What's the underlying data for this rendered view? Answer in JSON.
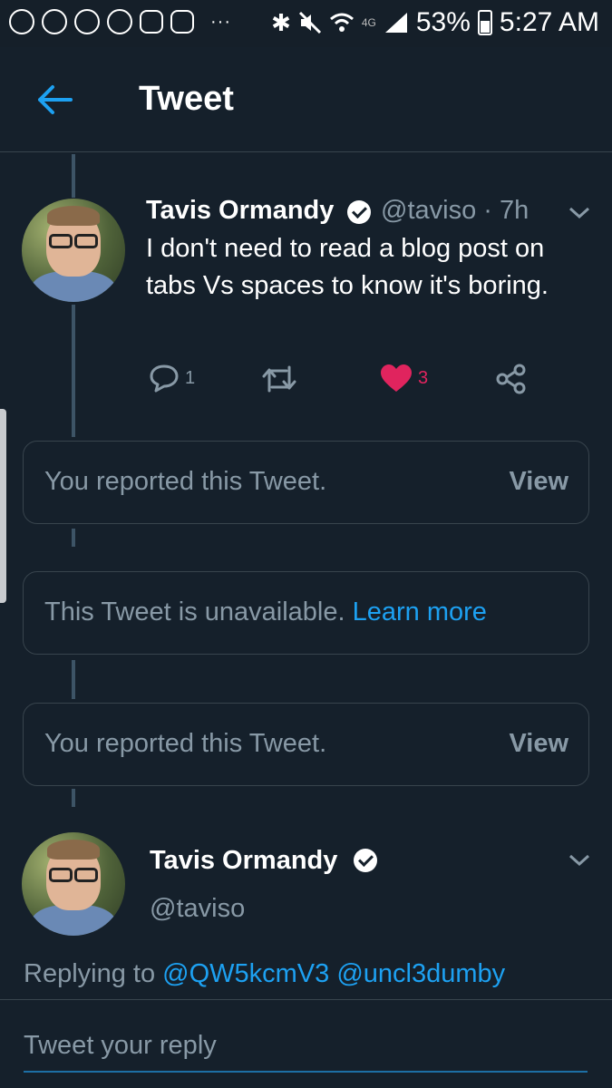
{
  "status_bar": {
    "battery": "53%",
    "time": "5:27 AM",
    "network": "4G",
    "dots": "···",
    "left_icons": [
      "chat-bubble-icon",
      "account-circle-icon",
      "shield-alert-icon",
      "messenger-icon",
      "instagram-icon",
      "instagram-icon"
    ],
    "right_icons": [
      "bluetooth-icon",
      "mute-icon",
      "wifi-icon",
      "signal-icon",
      "battery-icon"
    ]
  },
  "header": {
    "title": "Tweet",
    "back_icon": "arrow-left-icon"
  },
  "tweets": [
    {
      "name": "Tavis Ormandy",
      "handle": "@taviso",
      "time": "· 7h",
      "body": "I don't need to read a blog post on tabs Vs spaces to know it's boring.",
      "replies": "1",
      "likes": "3",
      "verified": true
    }
  ],
  "notices": [
    {
      "text": "You reported this Tweet.",
      "action": "View"
    },
    {
      "text": "This Tweet is unavailable.",
      "link": "Learn more"
    },
    {
      "text": "You reported this Tweet.",
      "action": "View"
    }
  ],
  "main_tweet": {
    "name": "Tavis Ormandy",
    "handle": "@taviso",
    "verified": true
  },
  "reply": {
    "replying_to_label": "Replying to",
    "mentions": [
      "@QW5kcmV3",
      "@uncl3dumby"
    ],
    "placeholder": "Tweet your reply"
  },
  "colors": {
    "background": "#15202b",
    "accent": "#1da1f2",
    "like": "#e0245e",
    "secondary_text": "#8899a6",
    "border": "#38444d"
  }
}
